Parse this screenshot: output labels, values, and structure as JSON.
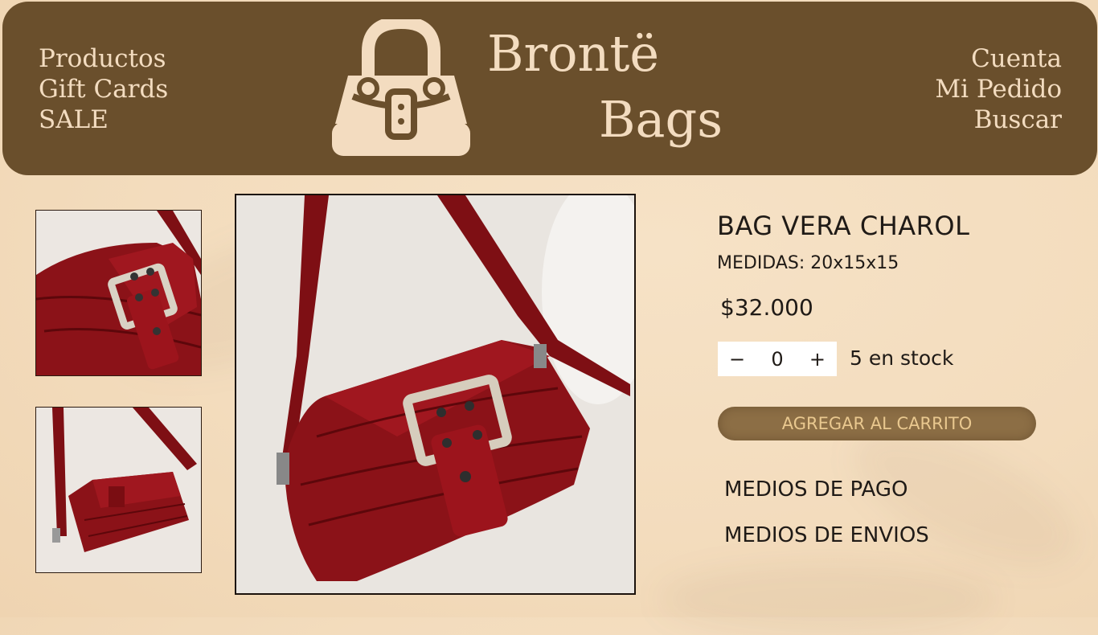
{
  "colors": {
    "header_bg": "#6a4f2c",
    "header_text": "#f3dcc0",
    "page_bg": "#f3dcbd",
    "cart_btn_bg": "#8c6e45",
    "cart_btn_text": "#e9c88f"
  },
  "nav_left": [
    "Productos",
    "Gift Cards",
    "SALE"
  ],
  "nav_right": [
    "Cuenta",
    "Mi Pedido",
    "Buscar"
  ],
  "brand": {
    "line1": "Brontë",
    "line2": "Bags",
    "logo_icon": "handbag-icon"
  },
  "product": {
    "title": "BAG VERA CHAROL",
    "measures": "MEDIDAS: 20x15x15",
    "price": "$32.000",
    "qty_minus": "−",
    "qty_value": "0",
    "qty_plus": "+",
    "stock": "5 en stock",
    "add_to_cart": "AGREGAR AL CARRITO"
  },
  "links": {
    "payment": "MEDIOS DE PAGO",
    "shipping": "MEDIOS DE ENVIOS"
  }
}
